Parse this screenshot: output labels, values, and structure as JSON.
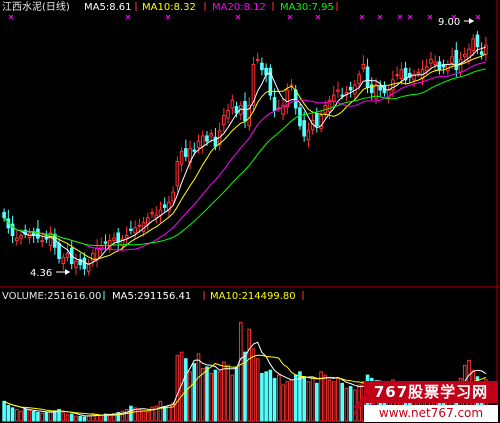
{
  "price_header": {
    "stock_label": "江西水泥(日线)",
    "ma5_text": "MA5:8.61",
    "ma10_text": "MA10:8.32",
    "ma20_text": "MA20:8.12",
    "ma30_text": "MA30:7.95",
    "colors": {
      "stock": "#e8e8e8",
      "ma5": "#ffffff",
      "ma10": "#ffff00",
      "ma20": "#ff00ff",
      "ma30": "#00ff00"
    }
  },
  "volume_header": {
    "volume_text": "VOLUME:251616.00",
    "vma5_text": "MA5:291156.41",
    "vma10_text": "MA10:214499.80"
  },
  "annotations": {
    "high_label": "9.00",
    "low_label": "4.36"
  },
  "watermark": {
    "brand": "767股票学习网",
    "url": "www.net767.com"
  },
  "colors": {
    "up": "#ff3232",
    "down": "#54ffff",
    "background": "#000000",
    "separator": "#b00000"
  },
  "chart_data": [
    {
      "type": "candlestick",
      "panel": "price",
      "title": "江西水泥(日线)",
      "ylim": [
        4.1,
        9.35
      ],
      "ma_periods": [
        5,
        10,
        20,
        30
      ],
      "ma_colors": [
        "#ffffff",
        "#ffff00",
        "#ff00ff",
        "#00ff00"
      ],
      "closes": [
        5.4,
        5.2,
        5.05,
        5.0,
        5.05,
        5.08,
        5.1,
        5.05,
        5.0,
        4.95,
        4.98,
        5.1,
        4.82,
        4.6,
        4.62,
        4.7,
        4.5,
        4.55,
        4.48,
        4.4,
        4.5,
        4.7,
        4.8,
        4.85,
        4.9,
        4.95,
        5.0,
        4.92,
        4.98,
        5.05,
        5.15,
        5.2,
        5.25,
        5.3,
        5.4,
        5.5,
        5.45,
        5.55,
        5.6,
        5.7,
        5.9,
        6.5,
        6.7,
        6.6,
        6.75,
        6.7,
        6.9,
        7.0,
        6.9,
        7.05,
        6.8,
        7.1,
        7.4,
        7.5,
        7.7,
        7.45,
        7.6,
        7.3,
        7.6,
        8.4,
        8.5,
        8.3,
        8.2,
        7.8,
        7.5,
        7.55,
        7.6,
        7.9,
        8.0,
        7.55,
        7.2,
        7.0,
        7.1,
        7.3,
        7.2,
        7.4,
        7.6,
        7.7,
        7.8,
        7.9,
        7.8,
        7.85,
        7.9,
        8.0,
        8.2,
        8.4,
        7.95,
        7.85,
        8.0,
        7.9,
        7.85,
        7.9,
        8.1,
        8.2,
        8.3,
        8.1,
        8.15,
        8.2,
        8.25,
        8.3,
        8.35,
        8.5,
        8.45,
        8.3,
        8.35,
        8.4,
        8.55,
        8.3,
        8.5,
        8.6,
        8.7,
        8.9,
        8.75,
        8.6,
        8.78
      ],
      "annotations": [
        {
          "text": "9.00",
          "type": "high"
        },
        {
          "text": "4.36",
          "type": "low"
        }
      ]
    },
    {
      "type": "bar",
      "panel": "volume",
      "title": "VOLUME",
      "ylim": [
        0,
        720000
      ],
      "current_volume": 251616.0,
      "ma5": 291156.41,
      "ma10": 214499.8,
      "volumes": [
        120000,
        95000,
        80000,
        70000,
        60000,
        72000,
        65000,
        58000,
        52000,
        48000,
        55000,
        60000,
        62000,
        70000,
        50000,
        38000,
        42000,
        30000,
        28000,
        25000,
        30000,
        45000,
        40000,
        35000,
        42000,
        38000,
        46000,
        52000,
        60000,
        70000,
        90000,
        80000,
        70000,
        62000,
        55000,
        85000,
        90000,
        120000,
        88000,
        95000,
        110000,
        400000,
        420000,
        380000,
        300000,
        350000,
        410000,
        320000,
        330000,
        290000,
        310000,
        300000,
        360000,
        340000,
        280000,
        330000,
        600000,
        420000,
        560000,
        440000,
        380000,
        290000,
        300000,
        310000,
        260000,
        280000,
        220000,
        240000,
        250000,
        280000,
        300000,
        270000,
        240000,
        260000,
        230000,
        300000,
        280000,
        250000,
        240000,
        260000,
        230000,
        200000,
        210000,
        190000,
        220000,
        240000,
        280000,
        260000,
        230000,
        210000,
        200000,
        230000,
        250000,
        220000,
        210000,
        190000,
        185000,
        200000,
        180000,
        170000,
        160000,
        175000,
        170000,
        150000,
        165000,
        180000,
        200000,
        230000,
        260000,
        340000,
        370000,
        310000,
        270000,
        240000,
        251616
      ]
    }
  ]
}
